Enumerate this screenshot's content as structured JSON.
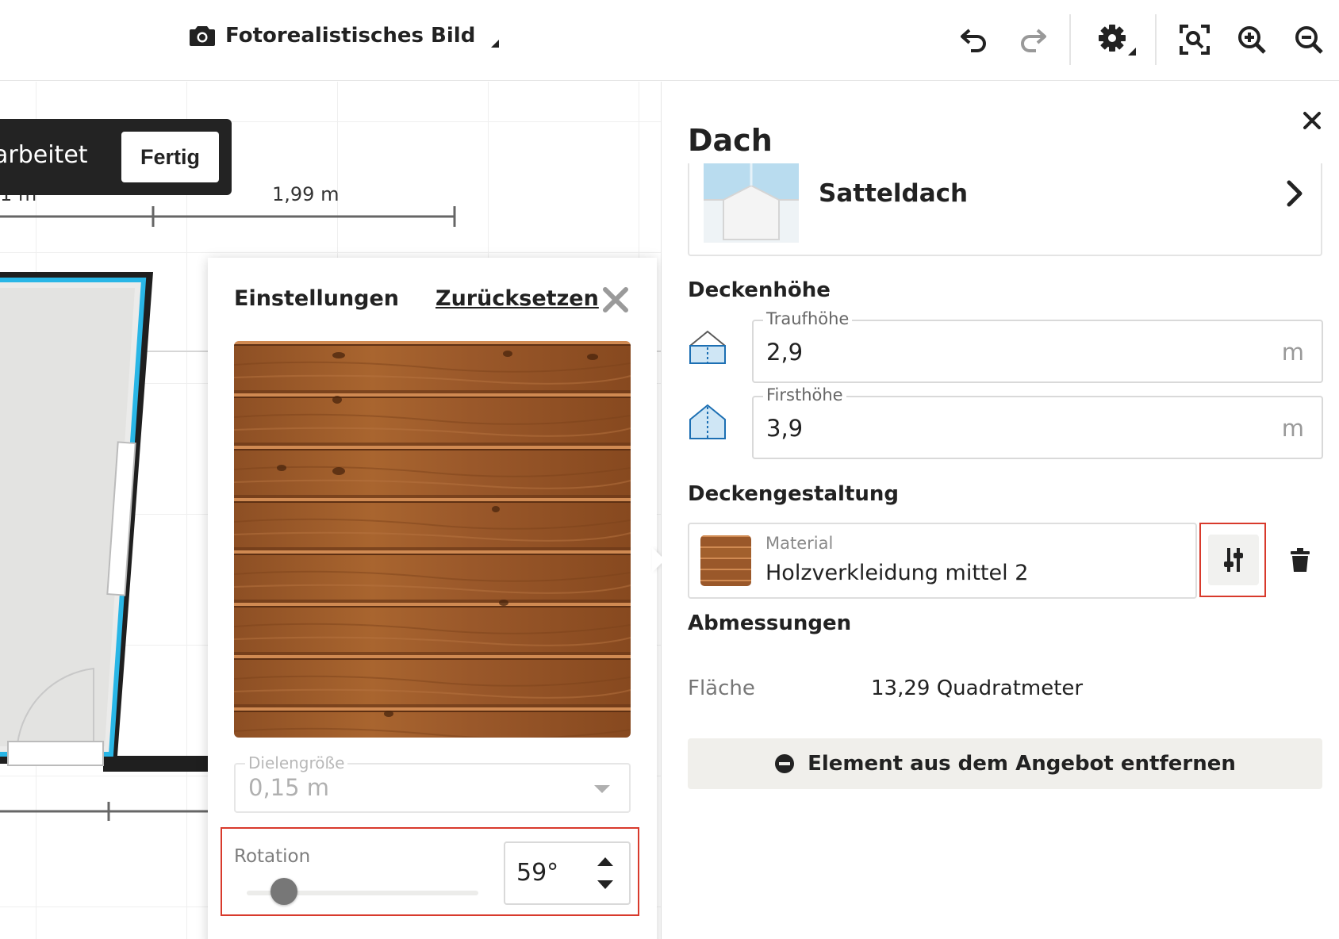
{
  "toolbar": {
    "view_mode_label": "Fotorealistisches Bild",
    "icons": [
      "camera-icon",
      "undo-icon",
      "redo-icon",
      "settings-icon",
      "fit-screen-icon",
      "zoom-in-icon",
      "zoom-out-icon"
    ]
  },
  "canvas": {
    "banner_text": "arbeitet",
    "done_label": "Fertig",
    "dimension_left": "1 m",
    "dimension_right": "1,99 m"
  },
  "settings_popup": {
    "title": "Einstellungen",
    "reset_label": "Zurücksetzen",
    "plank_size_label": "Dielengröße",
    "plank_size_value": "0,15 m",
    "rotation_label": "Rotation",
    "rotation_value": "59°",
    "rotation_slider_fraction": 0.16
  },
  "panel": {
    "title": "Dach",
    "roof_type": "Satteldach",
    "ceiling_height_heading": "Deckenhöhe",
    "eaves_label": "Traufhöhe",
    "eaves_value": "2,9",
    "eaves_unit": "m",
    "ridge_label": "Firsthöhe",
    "ridge_value": "3,9",
    "ridge_unit": "m",
    "ceiling_design_heading": "Deckengestaltung",
    "material_label": "Material",
    "material_value": "Holzverkleidung mittel 2",
    "dimensions_heading": "Abmessungen",
    "area_label": "Fläche",
    "area_value": "13,29 Quadratmeter",
    "remove_label": "Element aus dem Angebot entfernen"
  },
  "colors": {
    "accent_blue": "#29b6e6",
    "highlight_red": "#d83a2c",
    "wood_base": "#9a5a2c",
    "panel_button_bg": "#f0efeb"
  }
}
